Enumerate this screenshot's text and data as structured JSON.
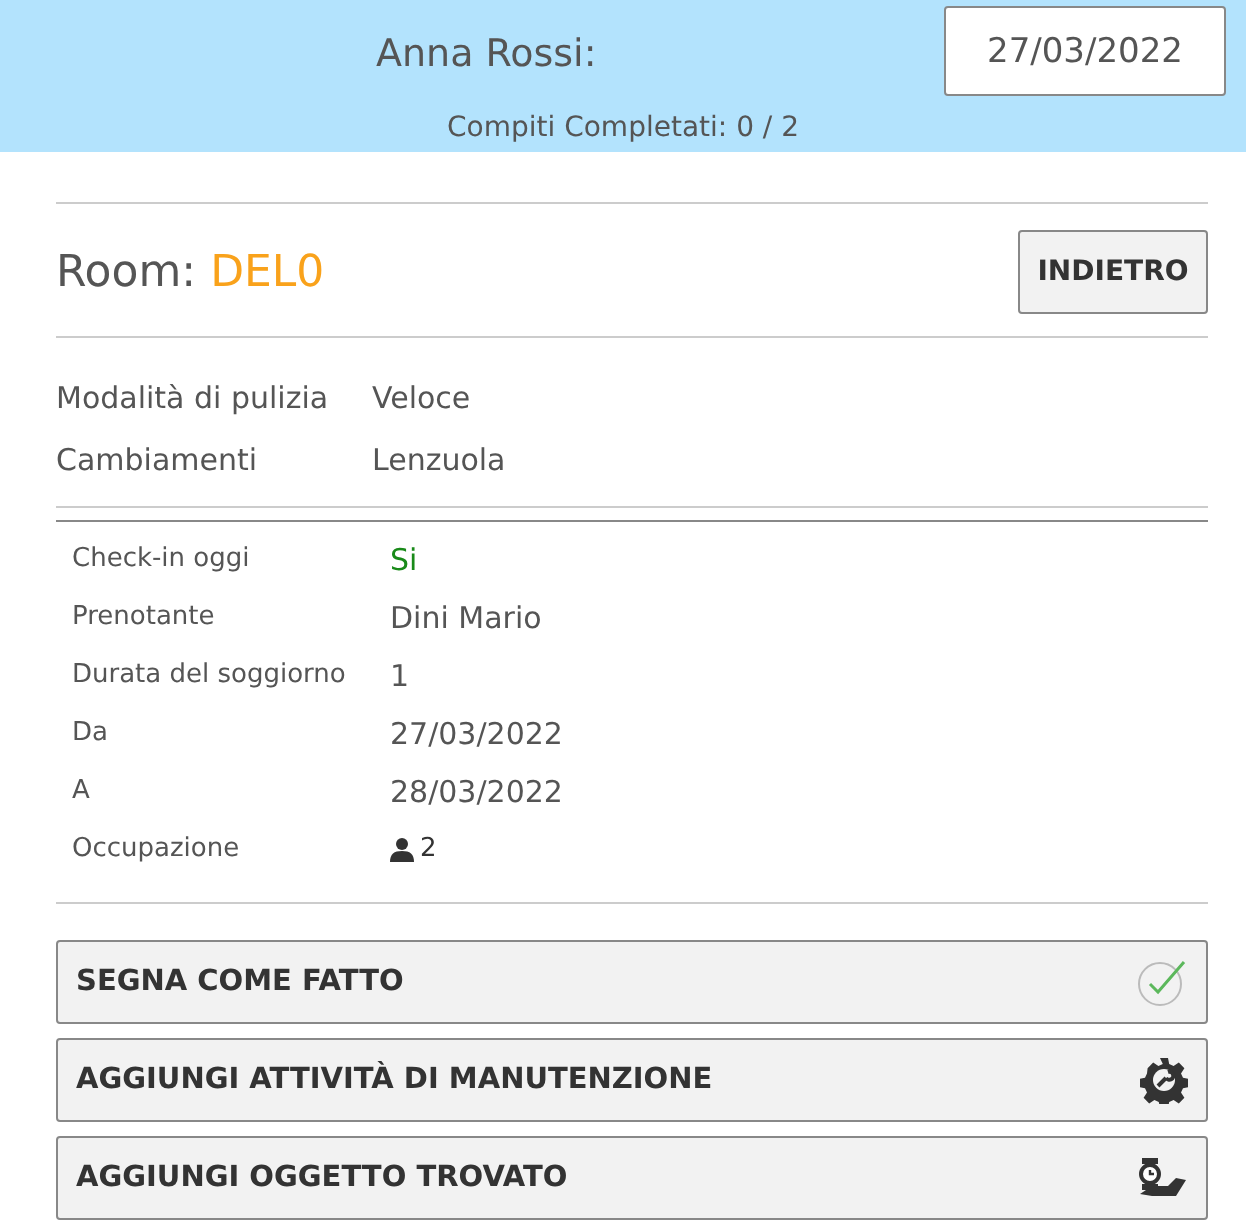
{
  "header": {
    "name": "Anna Rossi:",
    "date": "27/03/2022",
    "progress": "Compiti Completati: 0 / 2"
  },
  "room": {
    "label": "Room:",
    "code": "DEL0",
    "back_button": "INDIETRO"
  },
  "cleaning": [
    {
      "label": "Modalità di pulizia",
      "value": "Veloce"
    },
    {
      "label": "Cambiamenti",
      "value": "Lenzuola"
    }
  ],
  "details": [
    {
      "label": "Check-in oggi",
      "value": "Si",
      "kind": "status"
    },
    {
      "label": "Prenotante",
      "value": "Dini Mario",
      "kind": "text"
    },
    {
      "label": "Durata del soggiorno",
      "value": "1",
      "kind": "text"
    },
    {
      "label": "Da",
      "value": "27/03/2022",
      "kind": "text"
    },
    {
      "label": "A",
      "value": "28/03/2022",
      "kind": "text"
    },
    {
      "label": "Occupazione",
      "value": "2",
      "kind": "guests"
    }
  ],
  "actions": [
    {
      "label": "SEGNA COME FATTO",
      "kind": "done"
    },
    {
      "label": "AGGIUNGI ATTIVITÀ DI MANUTENZIONE",
      "kind": "maintenance"
    },
    {
      "label": "AGGIUNGI OGGETTO TROVATO",
      "kind": "found"
    }
  ]
}
